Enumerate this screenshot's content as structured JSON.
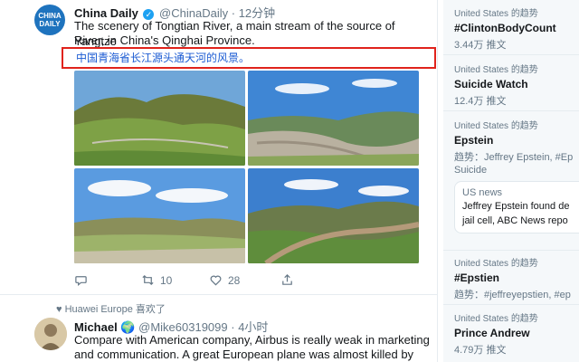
{
  "tweet1": {
    "avatar_line1": "CHINA",
    "avatar_line2": "DAILY",
    "name": "China Daily",
    "handle": "@ChinaDaily",
    "dot": "·",
    "time": "12分钟",
    "text_line1": "The scenery of Tongtian River, a main stream of the source of Yangtze",
    "text_line2": "River, in China's Qinghai Province.",
    "translation": "中国青海省长江源头通天河的风景。",
    "actions": {
      "reply_count": "",
      "retweet_count": "10",
      "like_count": "28"
    }
  },
  "tweet2": {
    "liked_by": "Huawei Europe 喜欢了",
    "name": "Michael",
    "handle": "@Mike60319099",
    "dot": "·",
    "time": "4小时",
    "text_line1": "Compare with American company, Airbus is really weak in marketing",
    "text_line2": "and communication. A great European plane was almost killed by"
  },
  "trends": [
    {
      "location": "United States 的趋势",
      "name": "#ClintonBodyCount",
      "meta": "3.44万 推文"
    },
    {
      "location": "United States 的趋势",
      "name": "Suicide Watch",
      "meta": "12.4万 推文"
    },
    {
      "location": "United States 的趋势",
      "name": "Epstein",
      "meta": "趋势：Jeffrey Epstein, #Ep",
      "meta2": "Suicide"
    },
    {
      "location": "United States 的趋势",
      "name": "#Epstien",
      "meta": "趋势：#jeffreyepstien, #ep"
    },
    {
      "location": "United States 的趋势",
      "name": "Prince Andrew",
      "meta": "4.79万 推文"
    }
  ],
  "news_card": {
    "source": "US news",
    "line1": "Jeffrey Epstein found de",
    "line2": "jail cell, ABC News repo"
  },
  "colors": {
    "accent": "#1da1f2",
    "highlight_border": "#e0231c",
    "translation_text": "#1b5bd3"
  }
}
